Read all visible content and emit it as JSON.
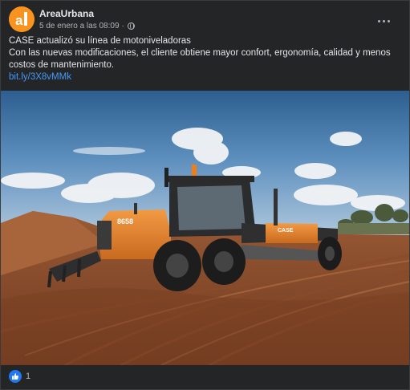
{
  "post": {
    "author": "AreaUrbana",
    "timestamp": "5 de enero a las 08:09",
    "separator": "·",
    "privacy_icon": "globe-icon",
    "more_icon": "more-options-icon",
    "headline": "CASE actualizó su línea de motoniveladoras",
    "body": "Con las nuevas modificaciones, el cliente obtiene mayor confort, ergonomía, calidad y menos costos de mantenimiento.",
    "link": "bit.ly/3X8vMMk"
  },
  "photo": {
    "model_badge": "8658",
    "brand_badge": "CASE"
  },
  "reactions": {
    "icon": "like-icon",
    "count": "1"
  },
  "colors": {
    "card_background": "#242526",
    "text": "#e4e6eb",
    "secondary_text": "#b0b3b8",
    "link": "#4599ff",
    "like_blue": "#2078f4",
    "case_orange": "#e8822d"
  }
}
